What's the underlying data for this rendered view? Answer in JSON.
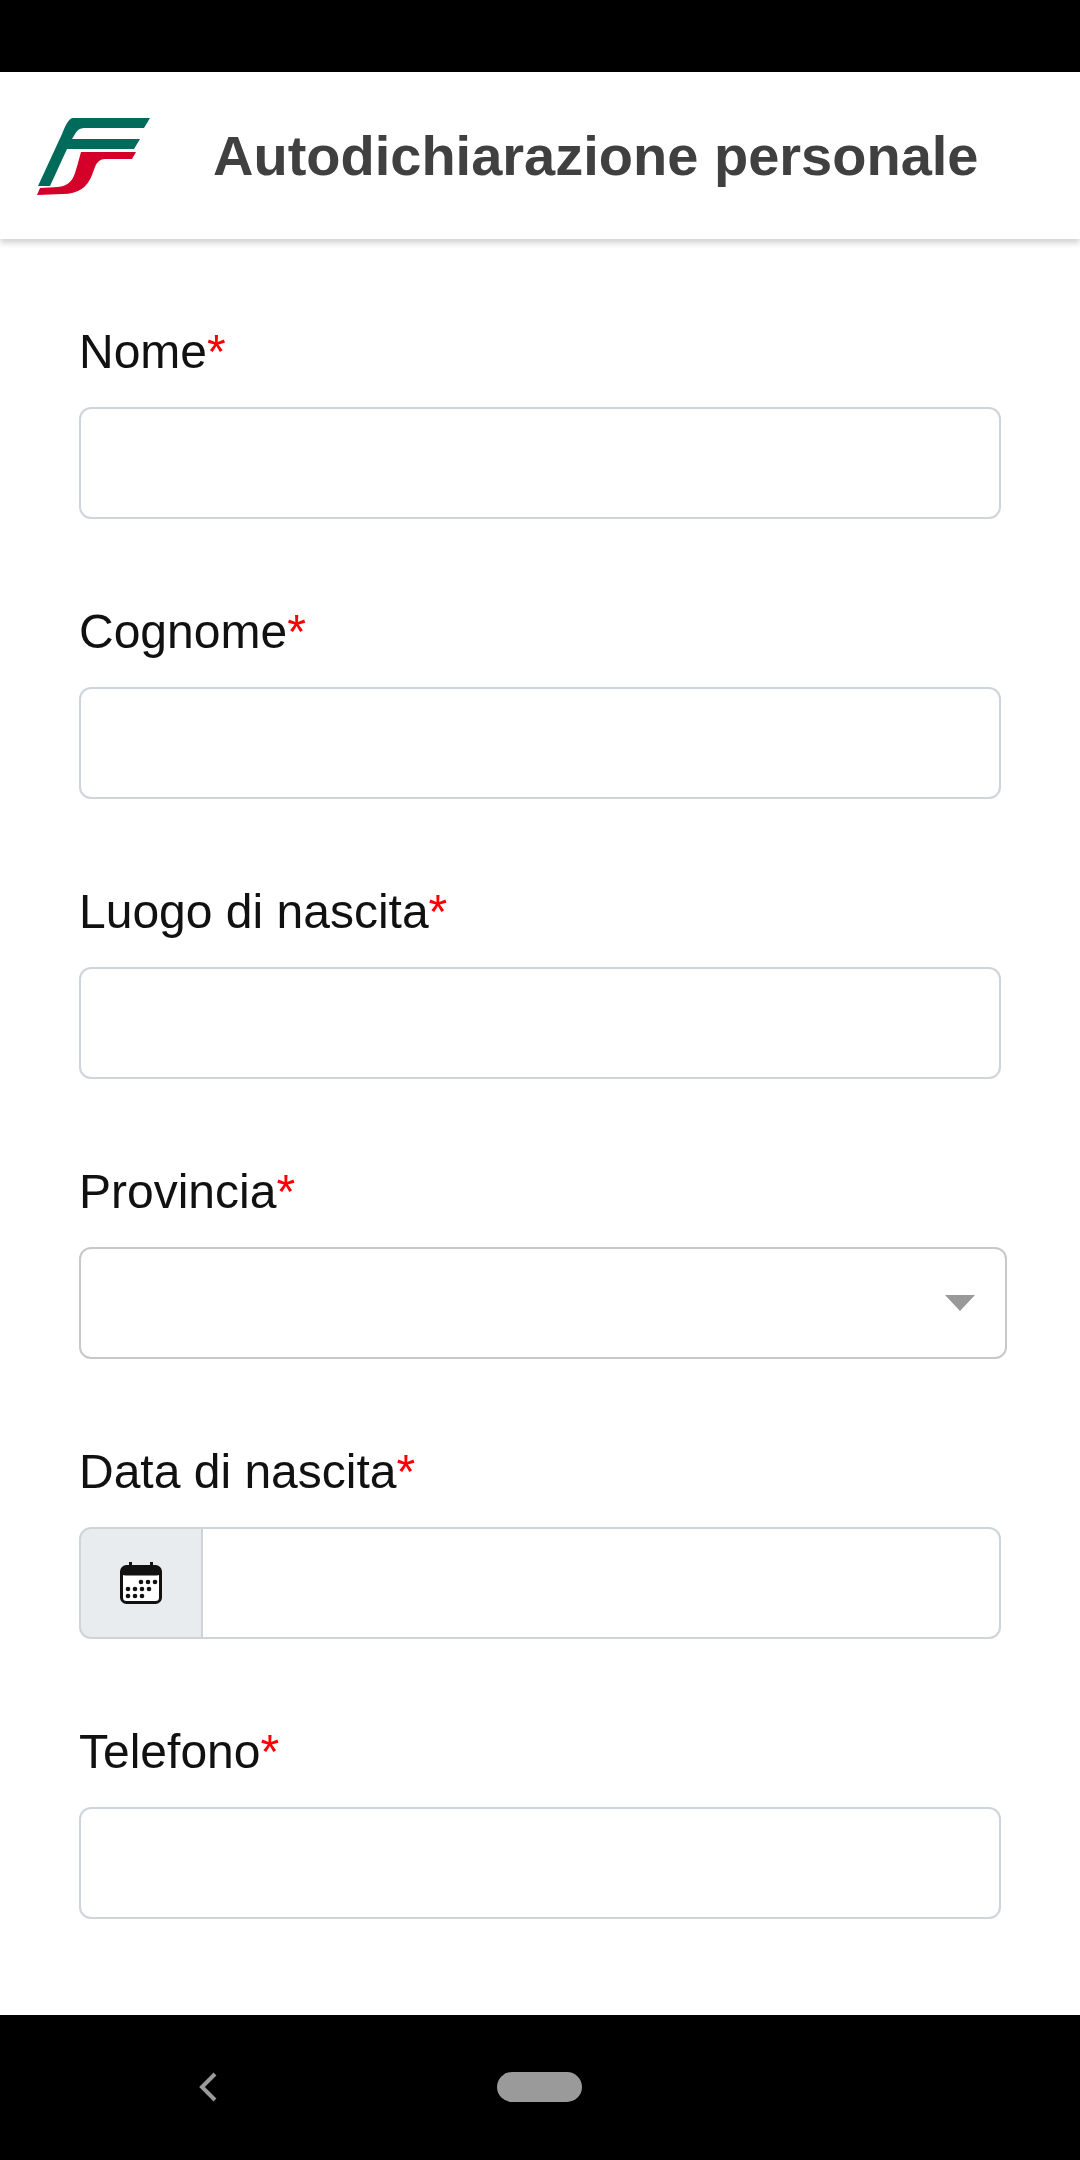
{
  "header": {
    "title": "Autodichiarazione personale"
  },
  "form": {
    "fields": [
      {
        "kind": "text",
        "label": "Nome",
        "required_mark": "*"
      },
      {
        "kind": "text",
        "label": "Cognome",
        "required_mark": "*"
      },
      {
        "kind": "text",
        "label": "Luogo di nascita",
        "required_mark": "*"
      },
      {
        "kind": "select",
        "label": "Provincia",
        "required_mark": "*"
      },
      {
        "kind": "date",
        "label": "Data di nascita",
        "required_mark": "*"
      },
      {
        "kind": "text",
        "label": "Telefono",
        "required_mark": "*"
      }
    ]
  }
}
